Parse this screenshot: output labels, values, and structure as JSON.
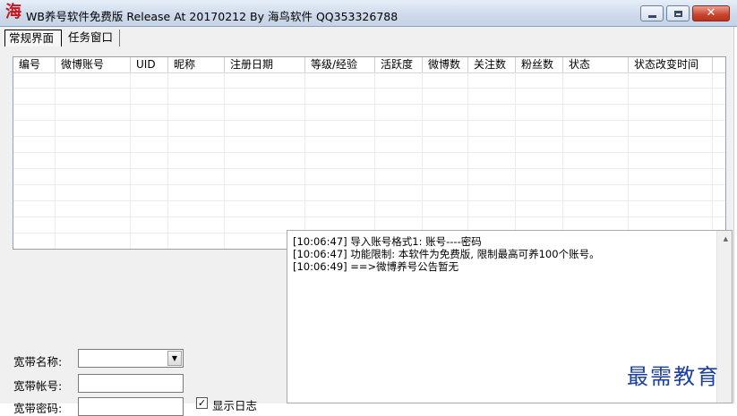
{
  "window": {
    "logo_char": "海",
    "title": "WB养号软件免费版 Release At 20170212 By 海鸟软件 QQ353326788",
    "min_icon": "minimize-icon",
    "max_icon": "maximize-icon",
    "close_icon": "close-icon",
    "close_glyph": "✕"
  },
  "tabs": [
    {
      "label": "常规界面",
      "active": true
    },
    {
      "label": "任务窗口",
      "active": false
    }
  ],
  "table": {
    "columns": [
      "编号",
      "微博账号",
      "UID",
      "昵称",
      "注册日期",
      "等级/经验",
      "活跃度",
      "微博数",
      "关注数",
      "粉丝数",
      "状态",
      "状态改变时间"
    ],
    "rows": []
  },
  "log": {
    "lines": [
      "[10:06:47] 导入账号格式1: 账号----密码",
      "[10:06:47] 功能限制: 本软件为免费版, 限制最高可养100个账号。",
      "[10:06:49] ==>微博养号公告暂无"
    ],
    "scroll_up_glyph": "▲"
  },
  "form": {
    "broadband_name_label": "宽带名称:",
    "broadband_name_value": "",
    "combo_arrow": "▼",
    "broadband_account_label": "宽带帐号:",
    "broadband_account_value": "",
    "broadband_password_label": "宽带密码:",
    "show_log_label": "显示日志",
    "show_log_checked": true,
    "check_glyph": "✓"
  },
  "watermark": "最需教育",
  "colors": {
    "title_bar": "#d2ddeb",
    "close_button": "#c8432b",
    "logo": "#c8161d",
    "watermark": "#1b3fa0"
  }
}
